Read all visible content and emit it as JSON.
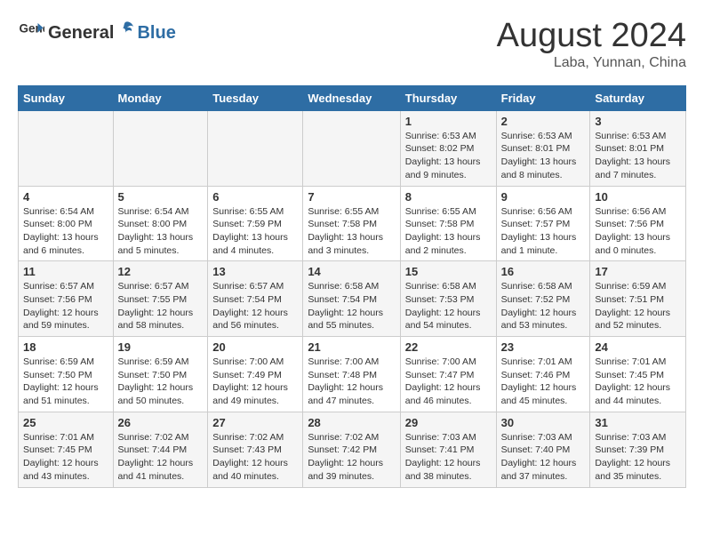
{
  "header": {
    "logo_general": "General",
    "logo_blue": "Blue",
    "title": "August 2024",
    "subtitle": "Laba, Yunnan, China"
  },
  "days_of_week": [
    "Sunday",
    "Monday",
    "Tuesday",
    "Wednesday",
    "Thursday",
    "Friday",
    "Saturday"
  ],
  "weeks": [
    [
      {
        "day": "",
        "info": ""
      },
      {
        "day": "",
        "info": ""
      },
      {
        "day": "",
        "info": ""
      },
      {
        "day": "",
        "info": ""
      },
      {
        "day": "1",
        "info": "Sunrise: 6:53 AM\nSunset: 8:02 PM\nDaylight: 13 hours and 9 minutes."
      },
      {
        "day": "2",
        "info": "Sunrise: 6:53 AM\nSunset: 8:01 PM\nDaylight: 13 hours and 8 minutes."
      },
      {
        "day": "3",
        "info": "Sunrise: 6:53 AM\nSunset: 8:01 PM\nDaylight: 13 hours and 7 minutes."
      }
    ],
    [
      {
        "day": "4",
        "info": "Sunrise: 6:54 AM\nSunset: 8:00 PM\nDaylight: 13 hours and 6 minutes."
      },
      {
        "day": "5",
        "info": "Sunrise: 6:54 AM\nSunset: 8:00 PM\nDaylight: 13 hours and 5 minutes."
      },
      {
        "day": "6",
        "info": "Sunrise: 6:55 AM\nSunset: 7:59 PM\nDaylight: 13 hours and 4 minutes."
      },
      {
        "day": "7",
        "info": "Sunrise: 6:55 AM\nSunset: 7:58 PM\nDaylight: 13 hours and 3 minutes."
      },
      {
        "day": "8",
        "info": "Sunrise: 6:55 AM\nSunset: 7:58 PM\nDaylight: 13 hours and 2 minutes."
      },
      {
        "day": "9",
        "info": "Sunrise: 6:56 AM\nSunset: 7:57 PM\nDaylight: 13 hours and 1 minute."
      },
      {
        "day": "10",
        "info": "Sunrise: 6:56 AM\nSunset: 7:56 PM\nDaylight: 13 hours and 0 minutes."
      }
    ],
    [
      {
        "day": "11",
        "info": "Sunrise: 6:57 AM\nSunset: 7:56 PM\nDaylight: 12 hours and 59 minutes."
      },
      {
        "day": "12",
        "info": "Sunrise: 6:57 AM\nSunset: 7:55 PM\nDaylight: 12 hours and 58 minutes."
      },
      {
        "day": "13",
        "info": "Sunrise: 6:57 AM\nSunset: 7:54 PM\nDaylight: 12 hours and 56 minutes."
      },
      {
        "day": "14",
        "info": "Sunrise: 6:58 AM\nSunset: 7:54 PM\nDaylight: 12 hours and 55 minutes."
      },
      {
        "day": "15",
        "info": "Sunrise: 6:58 AM\nSunset: 7:53 PM\nDaylight: 12 hours and 54 minutes."
      },
      {
        "day": "16",
        "info": "Sunrise: 6:58 AM\nSunset: 7:52 PM\nDaylight: 12 hours and 53 minutes."
      },
      {
        "day": "17",
        "info": "Sunrise: 6:59 AM\nSunset: 7:51 PM\nDaylight: 12 hours and 52 minutes."
      }
    ],
    [
      {
        "day": "18",
        "info": "Sunrise: 6:59 AM\nSunset: 7:50 PM\nDaylight: 12 hours and 51 minutes."
      },
      {
        "day": "19",
        "info": "Sunrise: 6:59 AM\nSunset: 7:50 PM\nDaylight: 12 hours and 50 minutes."
      },
      {
        "day": "20",
        "info": "Sunrise: 7:00 AM\nSunset: 7:49 PM\nDaylight: 12 hours and 49 minutes."
      },
      {
        "day": "21",
        "info": "Sunrise: 7:00 AM\nSunset: 7:48 PM\nDaylight: 12 hours and 47 minutes."
      },
      {
        "day": "22",
        "info": "Sunrise: 7:00 AM\nSunset: 7:47 PM\nDaylight: 12 hours and 46 minutes."
      },
      {
        "day": "23",
        "info": "Sunrise: 7:01 AM\nSunset: 7:46 PM\nDaylight: 12 hours and 45 minutes."
      },
      {
        "day": "24",
        "info": "Sunrise: 7:01 AM\nSunset: 7:45 PM\nDaylight: 12 hours and 44 minutes."
      }
    ],
    [
      {
        "day": "25",
        "info": "Sunrise: 7:01 AM\nSunset: 7:45 PM\nDaylight: 12 hours and 43 minutes."
      },
      {
        "day": "26",
        "info": "Sunrise: 7:02 AM\nSunset: 7:44 PM\nDaylight: 12 hours and 41 minutes."
      },
      {
        "day": "27",
        "info": "Sunrise: 7:02 AM\nSunset: 7:43 PM\nDaylight: 12 hours and 40 minutes."
      },
      {
        "day": "28",
        "info": "Sunrise: 7:02 AM\nSunset: 7:42 PM\nDaylight: 12 hours and 39 minutes."
      },
      {
        "day": "29",
        "info": "Sunrise: 7:03 AM\nSunset: 7:41 PM\nDaylight: 12 hours and 38 minutes."
      },
      {
        "day": "30",
        "info": "Sunrise: 7:03 AM\nSunset: 7:40 PM\nDaylight: 12 hours and 37 minutes."
      },
      {
        "day": "31",
        "info": "Sunrise: 7:03 AM\nSunset: 7:39 PM\nDaylight: 12 hours and 35 minutes."
      }
    ]
  ]
}
